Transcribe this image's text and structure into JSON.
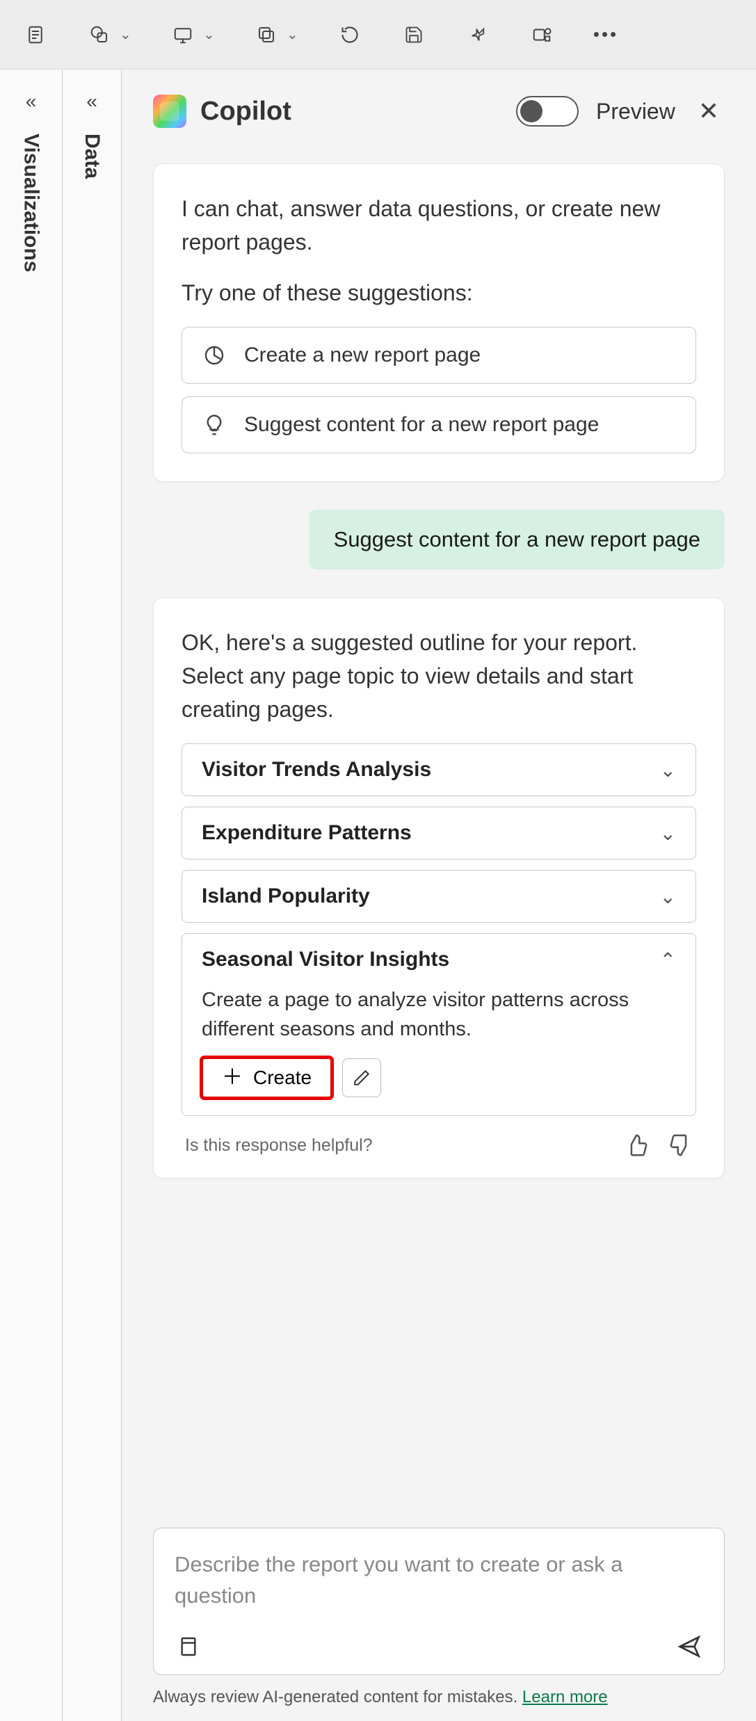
{
  "header": {
    "title": "Copilot",
    "preview_label": "Preview"
  },
  "sidebar_tabs": {
    "first": "Visualizations",
    "second": "Data"
  },
  "intro": {
    "line1": "I can chat, answer data questions, or create new report pages.",
    "line2": "Try one of these suggestions:",
    "suggestion1": "Create a new report page",
    "suggestion2": "Suggest content for a new report page"
  },
  "user_message": "Suggest content for a new report page",
  "outline": {
    "intro": "OK, here's a suggested outline for your report. Select any page topic to view details and start creating pages.",
    "topics": [
      {
        "title": "Visitor Trends Analysis"
      },
      {
        "title": "Expenditure Patterns"
      },
      {
        "title": "Island Popularity"
      },
      {
        "title": "Seasonal Visitor Insights",
        "description": "Create a page to analyze visitor patterns across different seasons and months.",
        "expanded": true
      }
    ],
    "create_label": "Create"
  },
  "feedback": {
    "question": "Is this response helpful?"
  },
  "input": {
    "placeholder": "Describe the report you want to create or ask a question"
  },
  "footer": {
    "note": "Always review AI-generated content for mistakes. ",
    "link": "Learn more"
  }
}
